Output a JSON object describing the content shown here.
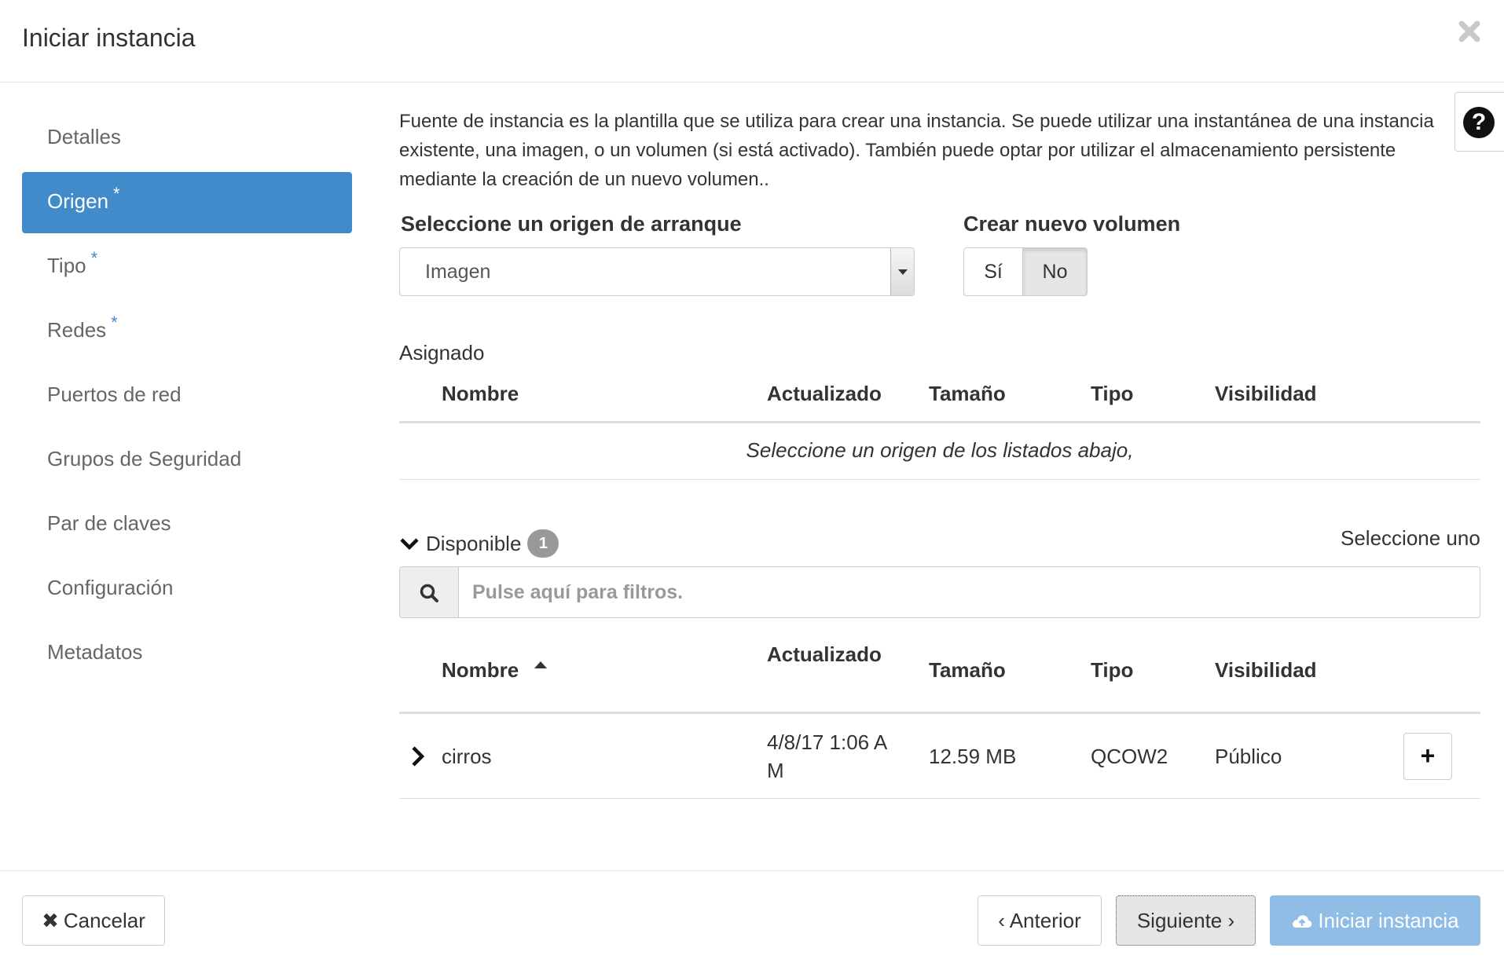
{
  "modal": {
    "title": "Iniciar instancia",
    "close_icon": "close-icon"
  },
  "nav": {
    "items": [
      {
        "label": "Detalles",
        "required": false
      },
      {
        "label": "Origen",
        "required": true,
        "active": true
      },
      {
        "label": "Tipo",
        "required": true
      },
      {
        "label": "Redes",
        "required": true
      },
      {
        "label": "Puertos de red",
        "required": false
      },
      {
        "label": "Grupos de Seguridad",
        "required": false
      },
      {
        "label": "Par de claves",
        "required": false
      },
      {
        "label": "Configuración",
        "required": false
      },
      {
        "label": "Metadatos",
        "required": false
      }
    ],
    "required_marker": "*"
  },
  "help": {
    "label": "?"
  },
  "intro": "Fuente de instancia es la plantilla que se utiliza para crear una instancia. Se puede utilizar una instantánea de una instancia existente, una imagen, o un volumen (si está activado). También puede optar por utilizar el almacenamiento persistente mediante la creación de un nuevo volumen..",
  "boot_source": {
    "label": "Seleccione un origen de arranque",
    "value": "Imagen"
  },
  "new_volume": {
    "label": "Crear nuevo volumen",
    "yes": "Sí",
    "no": "No",
    "selected": "No"
  },
  "allocated": {
    "title": "Asignado",
    "columns": [
      "Nombre",
      "Actualizado",
      "Tamaño",
      "Tipo",
      "Visibilidad"
    ],
    "empty_message": "Seleccione un origen de los listados abajo,"
  },
  "available": {
    "title": "Disponible",
    "count": "1",
    "select_hint": "Seleccione uno",
    "search_placeholder": "Pulse aquí para filtros.",
    "columns": [
      "Nombre",
      "Actualizado",
      "Tamaño",
      "Tipo",
      "Visibilidad"
    ],
    "rows": [
      {
        "name": "cirros",
        "updated_line1": "4/8/17 1:06 A",
        "updated_line2": "M",
        "size": "12.59 MB",
        "type": "QCOW2",
        "visibility": "Público",
        "add_label": "+"
      }
    ]
  },
  "footer": {
    "cancel": "Cancelar",
    "previous": "Anterior",
    "next": "Siguiente",
    "launch": "Iniciar instancia"
  },
  "colors": {
    "primary": "#428bca",
    "primary_disabled": "#8fbde6",
    "badge": "#999999"
  }
}
